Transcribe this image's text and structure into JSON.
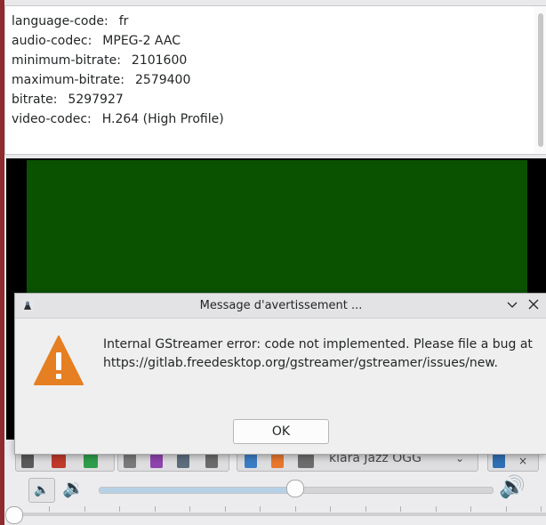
{
  "stream_tags": [
    {
      "key": "language-code:",
      "value": "fr"
    },
    {
      "key": "audio-codec:",
      "value": "MPEG-2 AAC"
    },
    {
      "key": "minimum-bitrate:",
      "value": "2101600"
    },
    {
      "key": "maximum-bitrate:",
      "value": "2579400"
    },
    {
      "key": "bitrate:",
      "value": "5297927"
    },
    {
      "key": "video-codec:",
      "value": "H.264 (High Profile)"
    }
  ],
  "player": {
    "station": "klara Jazz OGG",
    "volume_fraction": 0.5,
    "seek_fraction": 0.0
  },
  "dialog": {
    "title": "Message d'avertissement ...",
    "message": "Internal GStreamer error: code not implemented. Please file a bug at https://gitlab.freedesktop.org/gstreamer/gstreamer/issues/new.",
    "ok_label": "OK"
  },
  "colors": {
    "video_frame": "#0a5200",
    "warning_icon": "#e67e22",
    "window_edge": "#8f2a2e"
  },
  "icons": [
    "app-icon",
    "warning-icon",
    "chevron-down-icon",
    "close-icon",
    "mute-icon",
    "volume-low-icon",
    "volume-high-icon"
  ]
}
